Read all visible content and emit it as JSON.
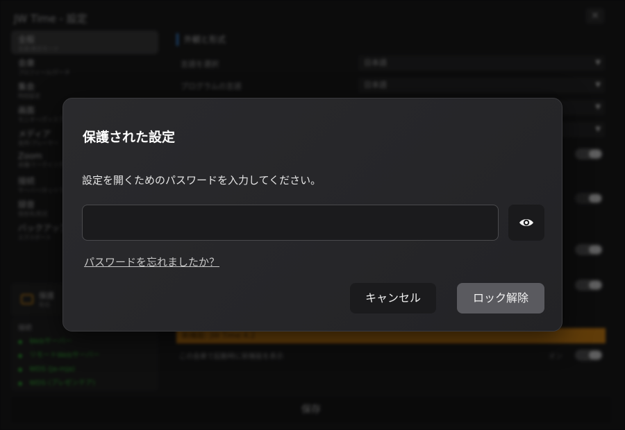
{
  "app": {
    "title": "JW Time - 設定",
    "close_icon": "close-icon",
    "save_label": "保存"
  },
  "sidebar": {
    "items": [
      {
        "label": "全般",
        "sub": "言語/表示モード"
      },
      {
        "label": "会衆",
        "sub": "プロフィール/データ"
      },
      {
        "label": "集会",
        "sub": "時刻設定"
      },
      {
        "label": "画面",
        "sub": "モニター/ディスプレイ"
      },
      {
        "label": "メディア",
        "sub": "音声/プレーヤー"
      },
      {
        "label": "Zoom",
        "sub": "会議/ミーティング"
      },
      {
        "label": "接続",
        "sub": "サーバー/ネットワーク"
      },
      {
        "label": "録音",
        "sub": "保存先/形式"
      },
      {
        "label": "バックアップ",
        "sub": "エクスポート"
      }
    ],
    "lock": {
      "label": "保護",
      "sub": "有効"
    },
    "connections": {
      "header": "接続",
      "items": [
        "Webサーバー",
        "リモートWebサーバー",
        "WDS (ja-mja)",
        "WDS (プレゼンテア)"
      ]
    }
  },
  "content": {
    "section_title": "外観と形式",
    "rows": [
      {
        "label": "言語を選択",
        "value": "日本語"
      },
      {
        "label": "プログラムの言語",
        "value": "日本語"
      }
    ],
    "banner": "新機能: JW Time 4.2",
    "banner_desc": "この会衆で起動時に新機能を表示",
    "banner_toggle_label": "オン"
  },
  "modal": {
    "title": "保護された設定",
    "description": "設定を開くためのパスワードを入力してください。",
    "password_value": "",
    "password_placeholder": "",
    "eye_icon": "eye-icon",
    "forgot_link": "パスワードを忘れましたか？",
    "cancel_label": "キャンセル",
    "unlock_label": "ロック解除"
  },
  "colors": {
    "accent_orange": "#e38a0f",
    "section_marker": "#3a8eea",
    "status_green": "#33cc33",
    "unlock_button": "#5a5a5f"
  }
}
